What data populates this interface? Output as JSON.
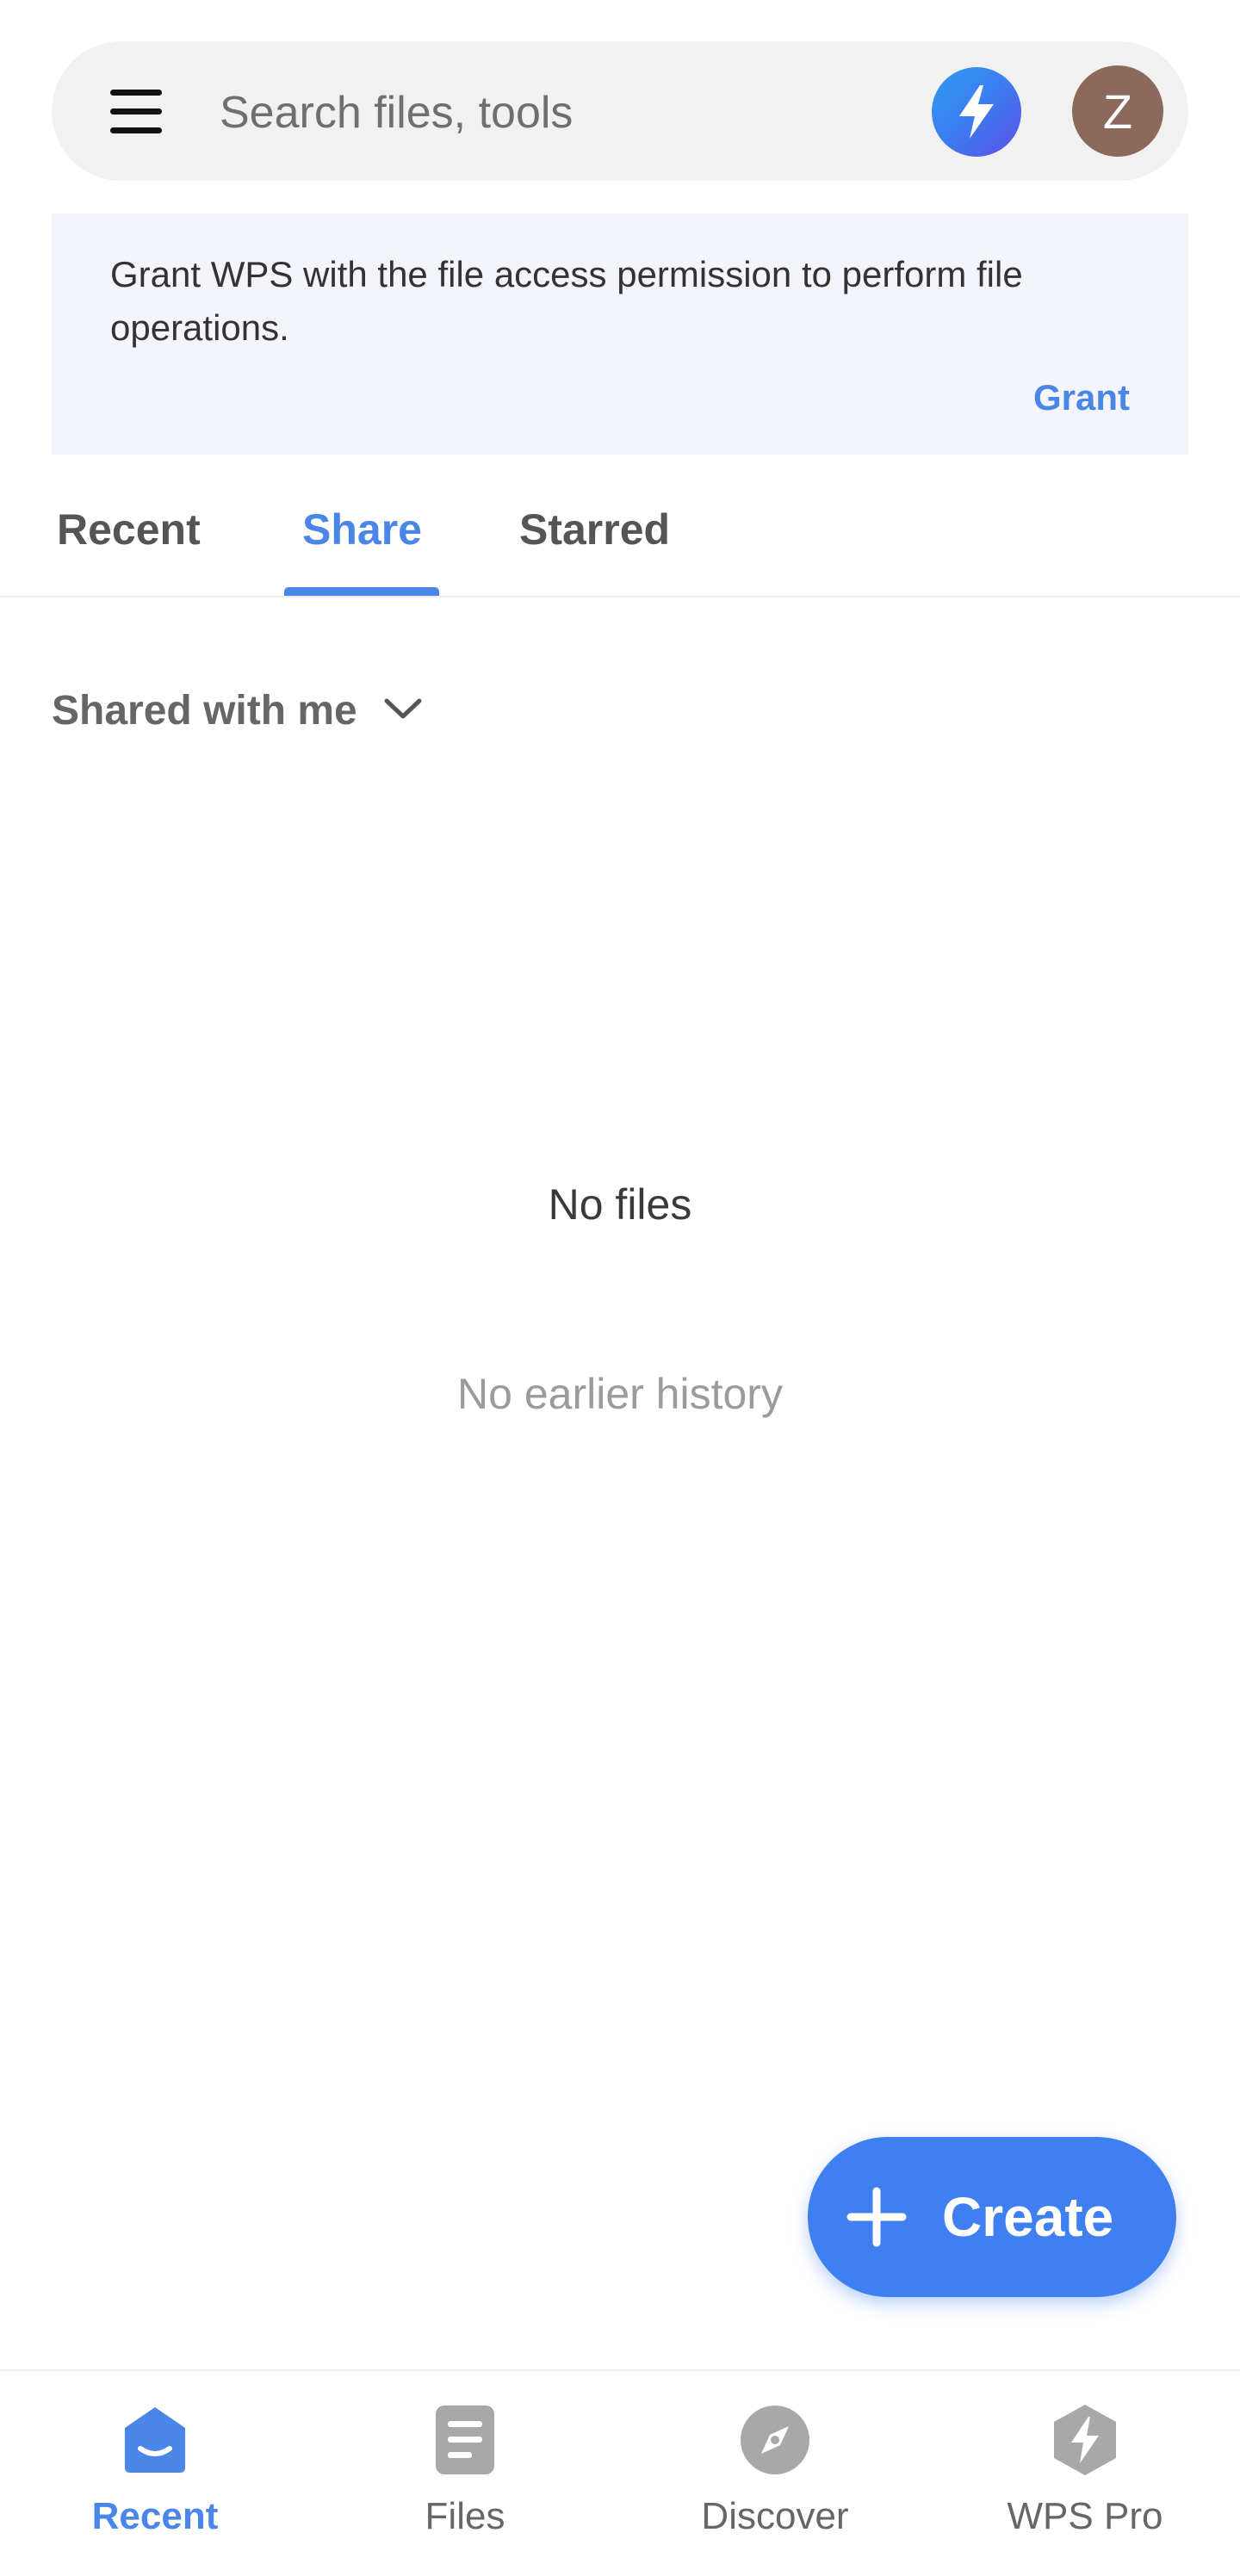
{
  "header": {
    "search_placeholder": "Search files, tools",
    "avatar_initial": "Z"
  },
  "banner": {
    "message": "Grant WPS with the file access permission to perform file operations.",
    "action_label": "Grant"
  },
  "tabs": [
    {
      "label": "Recent",
      "active": false
    },
    {
      "label": "Share",
      "active": true
    },
    {
      "label": "Starred",
      "active": false
    }
  ],
  "filter": {
    "label": "Shared with me"
  },
  "empty_state": {
    "title": "No files",
    "subtitle": "No earlier history"
  },
  "fab": {
    "label": "Create"
  },
  "bottom_nav": [
    {
      "label": "Recent",
      "icon": "home-icon",
      "active": true
    },
    {
      "label": "Files",
      "icon": "document-icon",
      "active": false
    },
    {
      "label": "Discover",
      "icon": "compass-icon",
      "active": false
    },
    {
      "label": "WPS Pro",
      "icon": "lightning-hexagon-icon",
      "active": false
    }
  ],
  "colors": {
    "accent": "#4a86e8",
    "fab": "#3f7ff0",
    "avatar": "#8b6a5c",
    "banner_bg": "#f3f5fa"
  }
}
